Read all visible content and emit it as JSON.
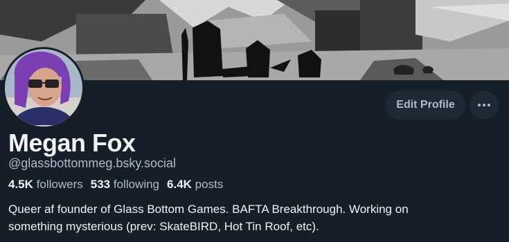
{
  "profile": {
    "display_name": "Megan Fox",
    "handle": "@glassbottommeg.bsky.social",
    "stats": {
      "followers_count": "4.5K",
      "followers_label": "followers",
      "following_count": "533",
      "following_label": "following",
      "posts_count": "6.4K",
      "posts_label": "posts"
    },
    "bio_line1": "Queer af founder of Glass Bottom Games. BAFTA Breakthrough. Working on",
    "bio_line2": "something mysterious (prev: SkateBIRD, Hot Tin Roof, etc)."
  },
  "actions": {
    "edit_profile_label": "Edit Profile",
    "more_icon": "ellipsis-icon"
  },
  "colors": {
    "background": "#161e27",
    "button_bg": "#1e2936",
    "muted_text": "#aebbc9",
    "primary_text": "#f1f3f5"
  }
}
